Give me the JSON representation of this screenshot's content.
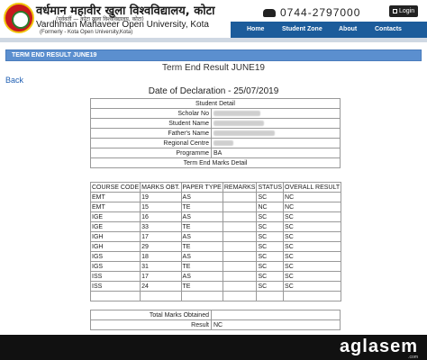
{
  "header": {
    "univ_hindi": "वर्धमान महावीर खुला विश्वविद्यालय, कोटा",
    "univ_hindi_sub": "(पूर्ववर्ती — कोटा खुला विश्वविद्यालय, कोटा)",
    "univ_en": "Vardhman Mahaveer Open University, Kota",
    "univ_en_sub": "(Formerly - Kota Open University,Kota)",
    "phone": "0744-2797000",
    "login_label": "Login"
  },
  "nav": {
    "items": [
      {
        "label": "Home"
      },
      {
        "label": "Student Zone"
      },
      {
        "label": "About"
      },
      {
        "label": "Contacts"
      }
    ]
  },
  "page": {
    "titlebar": "TERM END RESULT JUNE19",
    "result_title": "Term End Result JUNE19",
    "back_label": "Back",
    "declaration": "Date of Declaration - 25/07/2019"
  },
  "student": {
    "section_label": "Student Detail",
    "scholar_label": "Scholar No",
    "name_label": "Student Name",
    "father_label": "Father's Name",
    "centre_label": "Regional Centre",
    "programme_label": "Programme",
    "programme_value": "BA"
  },
  "marks": {
    "section_label": "Term End Marks Detail",
    "columns": [
      "COURSE CODE",
      "MARKS OBT.",
      "PAPER TYPE",
      "REMARKS",
      "STATUS",
      "OVERALL RESULT"
    ],
    "rows": [
      {
        "code": "EMT",
        "marks": "19",
        "type": "AS",
        "remarks": "",
        "status": "SC",
        "overall": "NC"
      },
      {
        "code": "EMT",
        "marks": "15",
        "type": "TE",
        "remarks": "",
        "status": "NC",
        "overall": "NC"
      },
      {
        "code": "IGE",
        "marks": "16",
        "type": "AS",
        "remarks": "",
        "status": "SC",
        "overall": "SC"
      },
      {
        "code": "IGE",
        "marks": "33",
        "type": "TE",
        "remarks": "",
        "status": "SC",
        "overall": "SC"
      },
      {
        "code": "IGH",
        "marks": "17",
        "type": "AS",
        "remarks": "",
        "status": "SC",
        "overall": "SC"
      },
      {
        "code": "IGH",
        "marks": "29",
        "type": "TE",
        "remarks": "",
        "status": "SC",
        "overall": "SC"
      },
      {
        "code": "IGS",
        "marks": "18",
        "type": "AS",
        "remarks": "",
        "status": "SC",
        "overall": "SC"
      },
      {
        "code": "IGS",
        "marks": "31",
        "type": "TE",
        "remarks": "",
        "status": "SC",
        "overall": "SC"
      },
      {
        "code": "ISS",
        "marks": "17",
        "type": "AS",
        "remarks": "",
        "status": "SC",
        "overall": "SC"
      },
      {
        "code": "ISS",
        "marks": "24",
        "type": "TE",
        "remarks": "",
        "status": "SC",
        "overall": "SC"
      }
    ]
  },
  "totals": {
    "total_label": "Total Marks Obtained",
    "total_value": "",
    "result_label": "Result",
    "result_value": "NC"
  },
  "watermark": {
    "text": "aglasem",
    "sub": ".com"
  }
}
